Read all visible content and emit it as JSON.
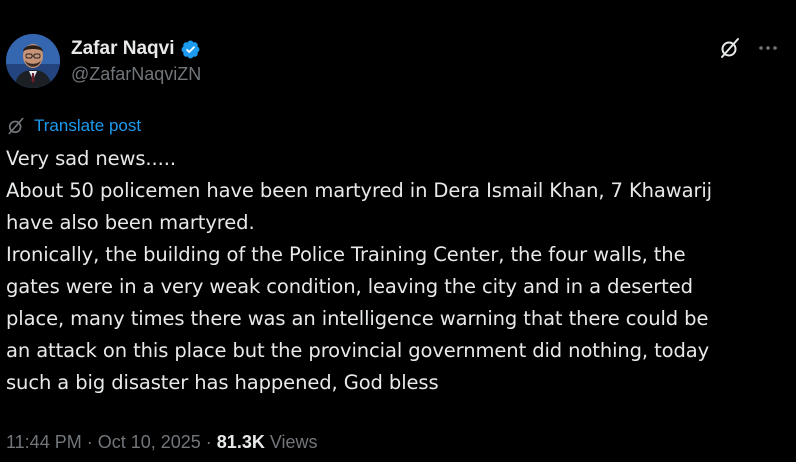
{
  "author": {
    "display_name": "Zafar Naqvi",
    "handle": "@ZafarNaqviZN",
    "verified_icon": "verified-badge-icon",
    "verified_color": "#1d9bf0"
  },
  "actions": {
    "grok_icon": "grok-icon",
    "more_icon": "more-options-icon"
  },
  "translate": {
    "label": "Translate post",
    "icon": "translate-icon"
  },
  "post": {
    "lines": [
      "Very sad news.....",
      "About 50 policemen have been martyred in Dera Ismail Khan, 7 Khawarij",
      "have also been martyred.",
      "Ironically, the building of the Police Training Center, the four walls, the",
      "gates were in a very weak condition, leaving the city and in a deserted",
      "place, many times there was an intelligence warning that there could be",
      "an attack on this place but the provincial government did nothing, today",
      "such a big disaster has happened, God bless"
    ]
  },
  "meta": {
    "time": "11:44 PM",
    "separator": "·",
    "date": "Oct 10, 2025",
    "views_count": "81.3K",
    "views_label": "Views"
  },
  "colors": {
    "background": "#000000",
    "text": "#e7e9ea",
    "secondary": "#71767b",
    "accent": "#1d9bf0"
  }
}
